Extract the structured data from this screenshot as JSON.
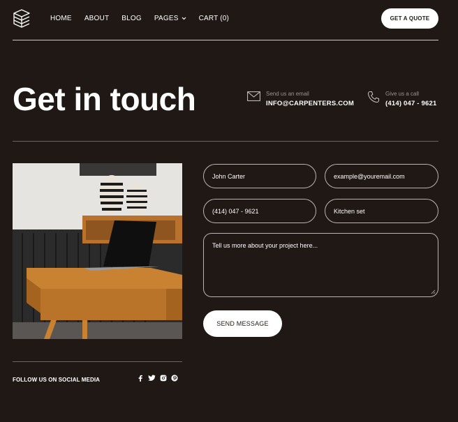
{
  "nav": {
    "items": [
      "HOME",
      "ABOUT",
      "BLOG",
      "PAGES",
      "CART (0)"
    ],
    "cta": "GET A QUOTE"
  },
  "hero": {
    "title": "Get in touch",
    "email_label": "Send us an email",
    "email_value": "INFO@CARPENTERS.COM",
    "phone_label": "Give us a call",
    "phone_value": "(414) 047 - 9621"
  },
  "form": {
    "name": "John Carter",
    "email": "example@youremail.com",
    "phone": "(414) 047 - 9621",
    "subject": "Kitchen set",
    "message": "Tell us more about your project here...",
    "submit": "SEND MESSAGE"
  },
  "footer": {
    "follow": "FOLLOW US ON SOCIAL MEDIA",
    "social_icons": [
      "facebook-icon",
      "twitter-icon",
      "instagram-icon",
      "pinterest-icon"
    ]
  },
  "colors": {
    "background": "#1f1815",
    "foreground": "#ffffff",
    "muted": "#9b938f"
  }
}
